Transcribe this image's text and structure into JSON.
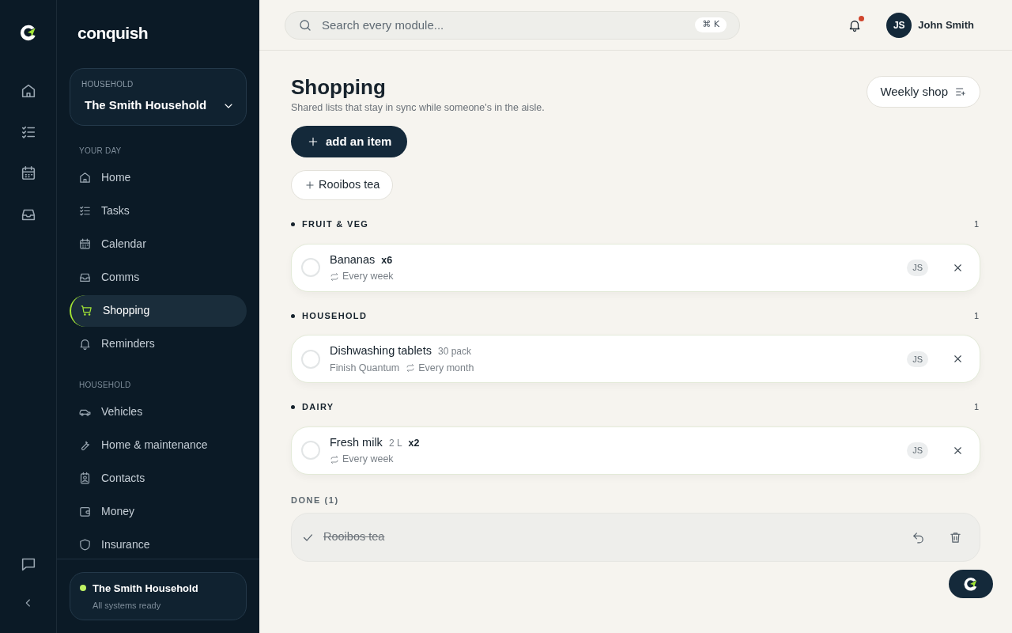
{
  "brand": "conquish",
  "household_switcher": {
    "label": "HOUSEHOLD",
    "value": "The Smith Household"
  },
  "nav_sections": [
    {
      "title": "YOUR DAY",
      "items": [
        {
          "label": "Home",
          "selected": false
        },
        {
          "label": "Tasks",
          "selected": false
        },
        {
          "label": "Calendar",
          "selected": false
        },
        {
          "label": "Comms",
          "selected": false
        },
        {
          "label": "Shopping",
          "selected": true
        },
        {
          "label": "Reminders",
          "selected": false
        }
      ]
    },
    {
      "title": "HOUSEHOLD",
      "items": [
        {
          "label": "Vehicles",
          "selected": false
        },
        {
          "label": "Home & maintenance",
          "selected": false
        },
        {
          "label": "Contacts",
          "selected": false
        },
        {
          "label": "Money",
          "selected": false
        },
        {
          "label": "Insurance",
          "selected": false
        }
      ]
    }
  ],
  "status_card": {
    "title": "The Smith Household",
    "subtitle": "All systems ready",
    "color": "#bef264"
  },
  "search": {
    "placeholder": "Search every module...",
    "shortcut": "⌘ K"
  },
  "notifications": {
    "unread": true
  },
  "user": {
    "initials": "JS",
    "name": "John Smith"
  },
  "page": {
    "title": "Shopping",
    "subtitle": "Shared lists that stay in sync while someone's in the aisle.",
    "list_button": "Weekly shop",
    "add_button": "add an item"
  },
  "suggestions": [
    "Rooibos tea"
  ],
  "groups": [
    {
      "title": "FRUIT & VEG",
      "count": "1",
      "items": [
        {
          "name": "Bananas",
          "qty": "x6",
          "repeat": "Every week",
          "assignee": "JS",
          "checked": false
        }
      ]
    },
    {
      "title": "HOUSEHOLD",
      "count": "1",
      "items": [
        {
          "name": "Dishwashing tablets",
          "size": "30 pack",
          "brand": "Finish Quantum",
          "repeat": "Every month",
          "assignee": "JS",
          "checked": false
        }
      ]
    },
    {
      "title": "DAIRY",
      "count": "1",
      "items": [
        {
          "name": "Fresh milk",
          "size": "2 L",
          "qty": "x2",
          "repeat": "Every week",
          "assignee": "JS",
          "checked": false
        }
      ]
    }
  ],
  "done": {
    "title": "DONE (1)",
    "items": [
      {
        "name": "Rooibos tea",
        "checked": true
      }
    ]
  }
}
